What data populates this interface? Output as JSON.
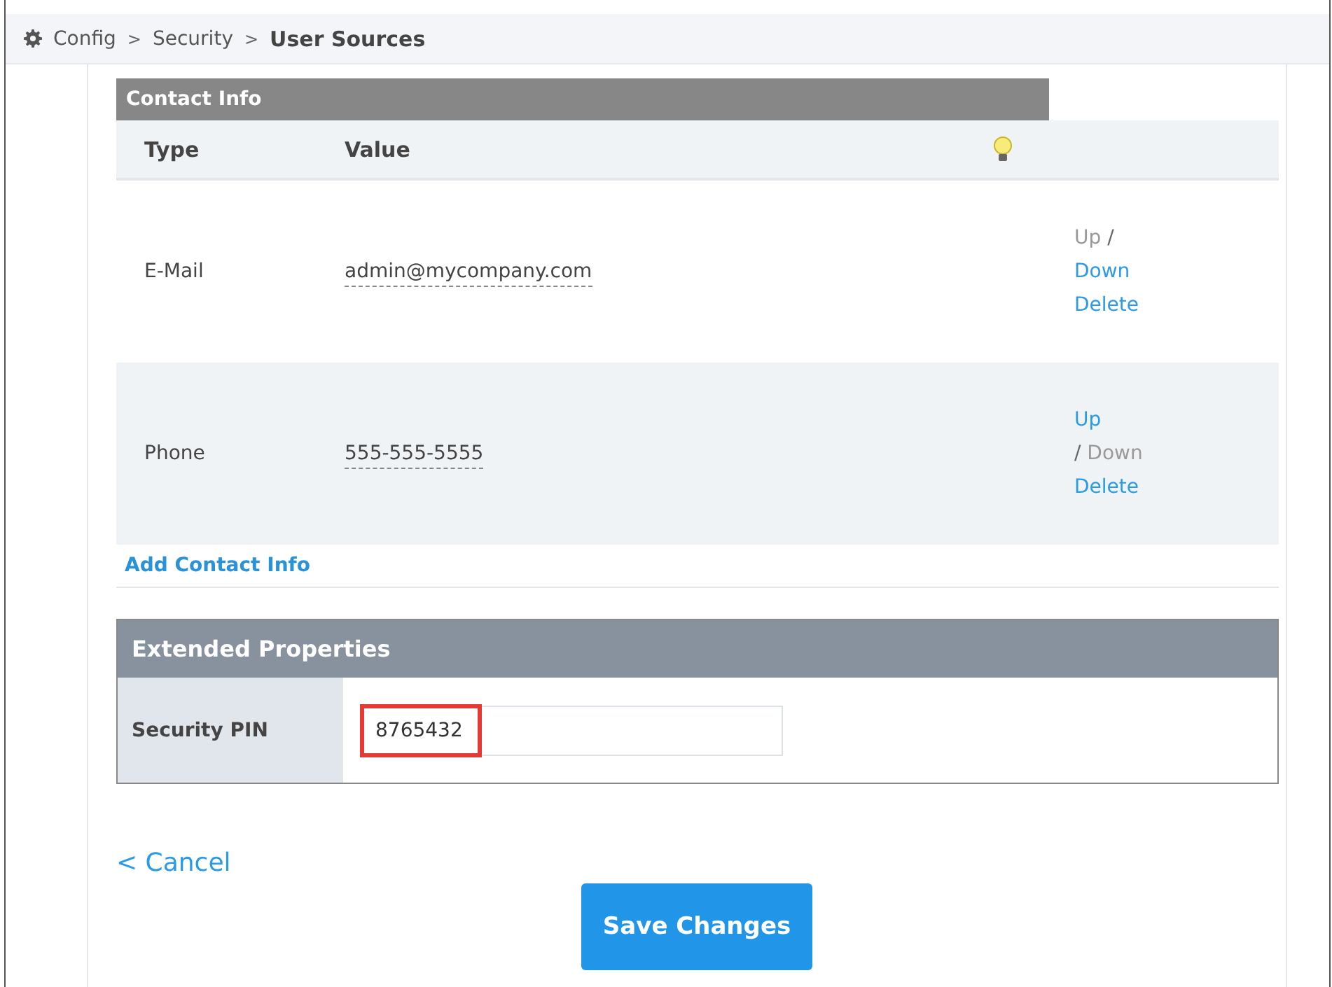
{
  "breadcrumb": {
    "items": [
      {
        "label": "Config",
        "current": false
      },
      {
        "label": "Security",
        "current": false
      },
      {
        "label": "User Sources",
        "current": true
      }
    ],
    "separator": ">"
  },
  "contact_info": {
    "title": "Contact Info",
    "columns": [
      "Type",
      "Value"
    ],
    "rows": [
      {
        "type": "E-Mail",
        "value": "admin@mycompany.com",
        "separator": "/",
        "move_links": [
          {
            "label": "Up",
            "enabled": false
          },
          {
            "label": "Down",
            "enabled": true
          }
        ],
        "delete": "Delete"
      },
      {
        "type": "Phone",
        "value": "555-555-5555",
        "separator": "/",
        "move_links": [
          {
            "label": "Up",
            "enabled": true
          },
          {
            "label": "Down",
            "enabled": false
          }
        ],
        "delete": "Delete"
      }
    ],
    "add_link": "Add Contact Info"
  },
  "extended_properties": {
    "title": "Extended Properties",
    "fields": [
      {
        "label": "Security PIN",
        "value": "8765432",
        "highlighted": true
      }
    ]
  },
  "cancel_link": "< Cancel",
  "save_button": "Save Changes"
}
